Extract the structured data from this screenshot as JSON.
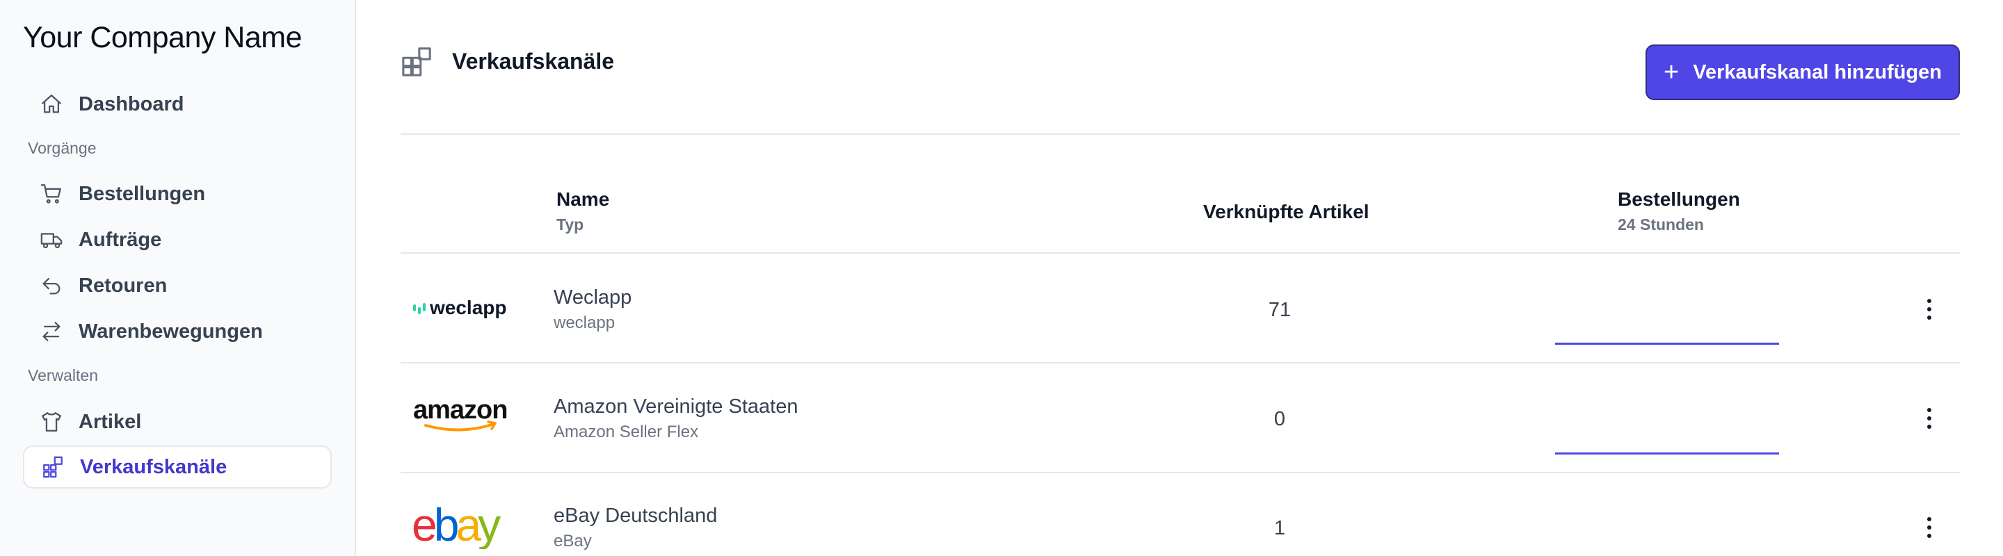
{
  "brand": "Your Company Name",
  "nav": {
    "dashboard": "Dashboard",
    "section_vorgaenge": "Vorgänge",
    "bestellungen": "Bestellungen",
    "auftraege": "Aufträge",
    "retouren": "Retouren",
    "warenbewegungen": "Warenbewegungen",
    "section_verwalten": "Verwalten",
    "artikel": "Artikel",
    "verkaufskanaele": "Verkaufskanäle",
    "active": "verkaufskanaele"
  },
  "page": {
    "title": "Verkaufskanäle",
    "add_button": "Verkaufskanal hinzufügen",
    "add_icon": "+"
  },
  "table": {
    "headers": {
      "name": "Name",
      "name_sub": "Typ",
      "articles": "Verknüpfte Artikel",
      "orders": "Bestellungen",
      "orders_sub": "24 Stunden"
    },
    "rows": [
      {
        "logo": "weclapp-logo",
        "logo_text": "weclapp",
        "name": "Weclapp",
        "type": "weclapp",
        "articles": "71",
        "orders_24h": 0
      },
      {
        "logo": "amazon-logo",
        "logo_text": "amazon",
        "name": "Amazon Vereinigte Staaten",
        "type": "Amazon Seller Flex",
        "articles": "0",
        "orders_24h": 0
      },
      {
        "logo": "ebay-logo",
        "logo_text": "ebay",
        "name": "eBay Deutschland",
        "type": "eBay",
        "articles": "1",
        "orders_24h": 0
      }
    ]
  },
  "colors": {
    "accent": "#4f46e5",
    "sidebar_bg": "#f8fafc",
    "weclapp_green": "#2dd4a7",
    "amazon_orange": "#ff9900",
    "ebay_red": "#e53238",
    "ebay_blue": "#0064d2",
    "ebay_yellow": "#f5af02",
    "ebay_green": "#86b817"
  }
}
